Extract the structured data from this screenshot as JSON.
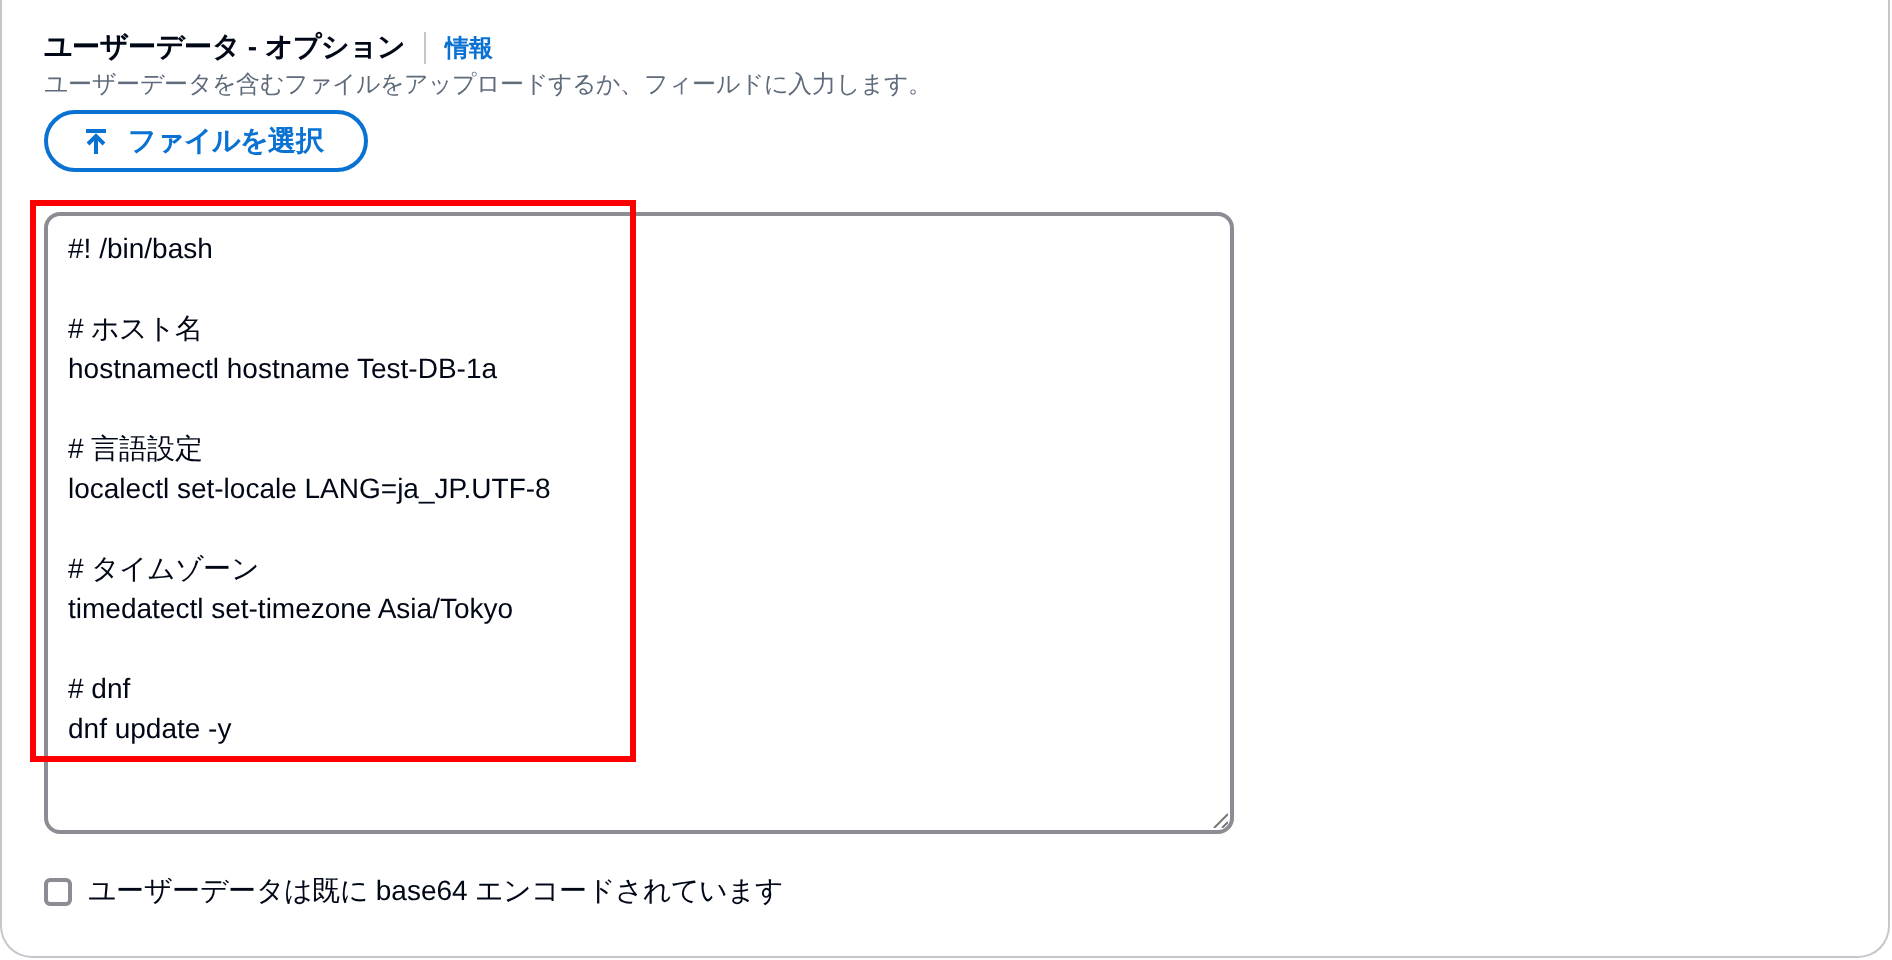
{
  "section": {
    "title": "ユーザーデータ - オプション",
    "info_link": "情報",
    "description": "ユーザーデータを含むファイルをアップロードするか、フィールドに入力します。",
    "upload_button": {
      "label": "ファイルを選択"
    },
    "user_data": {
      "value": "#! /bin/bash\n\n# ホスト名\nhostnamectl hostname Test-DB-1a\n\n# 言語設定\nlocalectl set-locale LANG=ja_JP.UTF-8\n\n# タイムゾーン\ntimedatectl set-timezone Asia/Tokyo\n\n# dnf\ndnf update -y"
    },
    "base64_checkbox": {
      "label": "ユーザーデータは既に base64 エンコードされています",
      "checked": false
    }
  },
  "annotation": {
    "highlight_box": true
  }
}
